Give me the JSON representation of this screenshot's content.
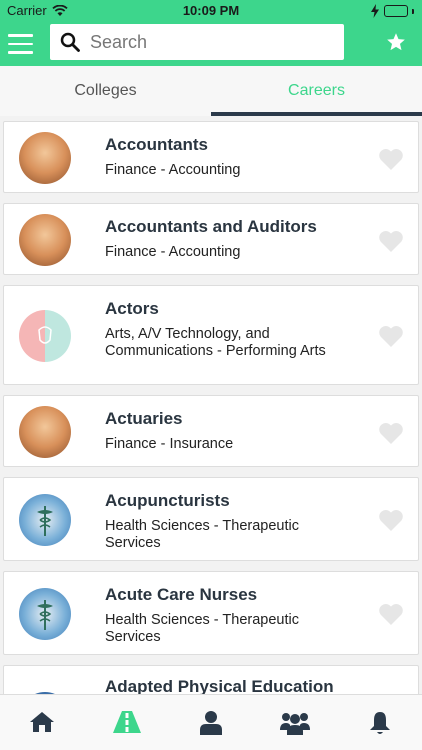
{
  "status_bar": {
    "carrier": "Carrier",
    "time": "10:09 PM"
  },
  "search": {
    "placeholder": "Search"
  },
  "tabs": [
    {
      "label": "Colleges",
      "active": false
    },
    {
      "label": "Careers",
      "active": true
    }
  ],
  "careers": [
    {
      "title": "Accountants",
      "subtitle": "Finance - Accounting",
      "image": "coins-icon"
    },
    {
      "title": "Accountants and Auditors",
      "subtitle": "Finance - Accounting",
      "image": "coins-icon"
    },
    {
      "title": "Actors",
      "subtitle": "Arts, A/V Technology, and Communications - Performing Arts",
      "image": "theater-masks-icon"
    },
    {
      "title": "Actuaries",
      "subtitle": "Finance - Insurance",
      "image": "coins-icon"
    },
    {
      "title": "Acupuncturists",
      "subtitle": "Health Sciences - Therapeutic Services",
      "image": "caduceus-icon"
    },
    {
      "title": "Acute Care Nurses",
      "subtitle": "Health Sciences - Therapeutic Services",
      "image": "caduceus-icon"
    },
    {
      "title": "Adapted Physical Education",
      "subtitle": "",
      "image": "thumbnail-icon"
    }
  ],
  "bottom_tabs": [
    "home-icon",
    "careers-road-icon",
    "profile-icon",
    "community-icon",
    "notifications-icon"
  ],
  "colors": {
    "brand": "#3dd68c",
    "tab_indicator": "#2b3a4a",
    "heart": "#e6e6e6"
  }
}
